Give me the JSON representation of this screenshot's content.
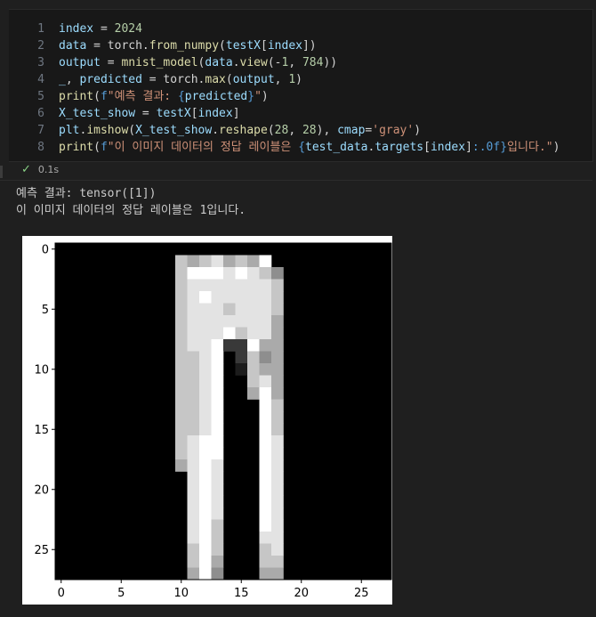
{
  "code_lines": [
    {
      "n": "1",
      "tokens": [
        [
          "v",
          "index"
        ],
        [
          "o",
          " = "
        ],
        [
          "n",
          "2024"
        ]
      ]
    },
    {
      "n": "2",
      "tokens": [
        [
          "v",
          "data"
        ],
        [
          "o",
          " = torch."
        ],
        [
          "f",
          "from_numpy"
        ],
        [
          "o",
          "("
        ],
        [
          "v",
          "testX"
        ],
        [
          "o",
          "["
        ],
        [
          "v",
          "index"
        ],
        [
          "o",
          "])"
        ]
      ]
    },
    {
      "n": "3",
      "tokens": [
        [
          "v",
          "output"
        ],
        [
          "o",
          " = "
        ],
        [
          "f",
          "mnist_model"
        ],
        [
          "o",
          "("
        ],
        [
          "v",
          "data"
        ],
        [
          "o",
          "."
        ],
        [
          "f",
          "view"
        ],
        [
          "o",
          "(-"
        ],
        [
          "n",
          "1"
        ],
        [
          "o",
          ", "
        ],
        [
          "n",
          "784"
        ],
        [
          "o",
          "))"
        ]
      ]
    },
    {
      "n": "4",
      "tokens": [
        [
          "v",
          "_"
        ],
        [
          "o",
          ", "
        ],
        [
          "v",
          "predicted"
        ],
        [
          "o",
          " = torch."
        ],
        [
          "f",
          "max"
        ],
        [
          "o",
          "("
        ],
        [
          "v",
          "output"
        ],
        [
          "o",
          ", "
        ],
        [
          "n",
          "1"
        ],
        [
          "o",
          ")"
        ]
      ]
    },
    {
      "n": "5",
      "tokens": [
        [
          "f",
          "print"
        ],
        [
          "o",
          "("
        ],
        [
          "k",
          "f"
        ],
        [
          "s",
          "\"예측 결과: "
        ],
        [
          "c-blue",
          "{"
        ],
        [
          "v",
          "predicted"
        ],
        [
          "c-blue",
          "}"
        ],
        [
          "s",
          "\""
        ],
        [
          "o",
          ")"
        ]
      ]
    },
    {
      "n": "6",
      "tokens": [
        [
          "v",
          "X_test_show"
        ],
        [
          "o",
          " = "
        ],
        [
          "v",
          "testX"
        ],
        [
          "o",
          "["
        ],
        [
          "v",
          "index"
        ],
        [
          "o",
          "]"
        ]
      ]
    },
    {
      "n": "7",
      "tokens": [
        [
          "v",
          "plt"
        ],
        [
          "o",
          "."
        ],
        [
          "f",
          "imshow"
        ],
        [
          "o",
          "("
        ],
        [
          "v",
          "X_test_show"
        ],
        [
          "o",
          "."
        ],
        [
          "f",
          "reshape"
        ],
        [
          "o",
          "("
        ],
        [
          "n",
          "28"
        ],
        [
          "o",
          ", "
        ],
        [
          "n",
          "28"
        ],
        [
          "o",
          "), "
        ],
        [
          "v",
          "cmap"
        ],
        [
          "o",
          "="
        ],
        [
          "s",
          "'gray'"
        ],
        [
          "o",
          ")"
        ]
      ]
    },
    {
      "n": "8",
      "tokens": [
        [
          "f",
          "print"
        ],
        [
          "o",
          "("
        ],
        [
          "k",
          "f"
        ],
        [
          "s",
          "\"이 이미지 데이터의 정답 레이블은 "
        ],
        [
          "c-blue",
          "{"
        ],
        [
          "v",
          "test_data"
        ],
        [
          "o",
          "."
        ],
        [
          "v",
          "targets"
        ],
        [
          "o",
          "["
        ],
        [
          "v",
          "index"
        ],
        [
          "o",
          "]"
        ],
        [
          "c-blue",
          ":.0f}"
        ],
        [
          "s",
          "입니다.\""
        ],
        [
          "o",
          ")"
        ]
      ]
    }
  ],
  "status": {
    "check_icon": "check-icon",
    "duration": "0.1s"
  },
  "output": {
    "line1": "예측 결과: tensor([1])",
    "line2": "이 이미지 데이터의 정답 레이블은 1입니다."
  },
  "chart_data": {
    "type": "heatmap",
    "colormap": "gray",
    "size": [
      28,
      28
    ],
    "xticks": [
      0,
      5,
      10,
      15,
      20,
      25
    ],
    "yticks": [
      0,
      5,
      10,
      15,
      20,
      25
    ],
    "rows": [
      "000000000000000000000000000",
      "000000000076786769000000000",
      "000000000079998987500000000",
      "000000000078888888700000000",
      "000000000078988888700000000",
      "000000000078887888700000000",
      "000000000078888888600000000",
      "000000000078889788600000000",
      "000000000078892296600000000",
      "000000000077890275600000000",
      "000000000077890176600000000",
      "000000000077890078600000000",
      "000000000077890069600000000",
      "000000000077890009700000000",
      "000000000077890009700000000",
      "000000000077890009700000000",
      "000000000078990009800000000",
      "000000000078990009800000000",
      "000000000068980009800000000",
      "000000000008980009800000000",
      "000000000008980009800000000",
      "000000000008980009800000000",
      "000000000008980009800000000",
      "000000000008970009800000000",
      "000000000008970008800000000",
      "000000000007970007800000000",
      "000000000007960007700000000",
      "000000000006950006600000000"
    ]
  }
}
